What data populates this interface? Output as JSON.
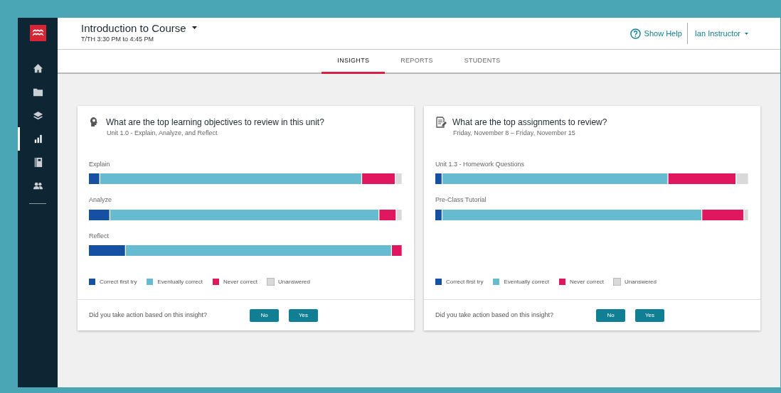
{
  "sidebar": {
    "items": [
      {
        "kind": "home",
        "selected": false
      },
      {
        "kind": "folder",
        "selected": false
      },
      {
        "kind": "layers",
        "selected": false
      },
      {
        "kind": "chart",
        "selected": true
      },
      {
        "kind": "notebook",
        "selected": false
      },
      {
        "kind": "people",
        "selected": false
      }
    ]
  },
  "header": {
    "course_title": "Introduction to Course",
    "schedule": "T/TH 3:30 PM to 4:45 PM",
    "help": "Show Help",
    "user": "Ian Instructor"
  },
  "tabs": [
    {
      "label": "INSIGHTS",
      "selected": true
    },
    {
      "label": "REPORTS",
      "selected": false
    },
    {
      "label": "STUDENTS",
      "selected": false
    }
  ],
  "cards": [
    {
      "kind": "objectives",
      "title": "What are the top learning objectives to review in this unit?",
      "subtitle": "Unit 1.0 - Explain, Analyze, and Reflect",
      "rows": [
        {
          "label": "Explain"
        },
        {
          "label": "Analyze"
        },
        {
          "label": "Reflect"
        }
      ],
      "legend": [
        {
          "label": "Correct first try",
          "color": "#1550a3"
        },
        {
          "label": "Eventually correct",
          "color": "#66bbd0"
        },
        {
          "label": "Never correct",
          "color": "#e0165f"
        },
        {
          "label": "Unanswered",
          "color": "#d9d9d9"
        }
      ],
      "question": "Did you take action based on this insight?",
      "buttons": [
        "No",
        "Yes"
      ]
    },
    {
      "kind": "assignments",
      "title": "What are the top assignments to review?",
      "subtitle": "Friday, November 8 – Friday, November 15",
      "rows": [
        {
          "label": "Unit 1.3 - Homework Questions"
        },
        {
          "label": "Pre-Class Tutorial"
        }
      ],
      "legend": [
        {
          "label": "Correct first try",
          "color": "#1550a3"
        },
        {
          "label": "Eventually correct",
          "color": "#66bbd0"
        },
        {
          "label": "Never correct",
          "color": "#e0165f"
        },
        {
          "label": "Unanswered",
          "color": "#d9d9d9"
        }
      ],
      "question": "Did you take action based on this insight?",
      "buttons": [
        "No",
        "Yes"
      ]
    }
  ]
}
